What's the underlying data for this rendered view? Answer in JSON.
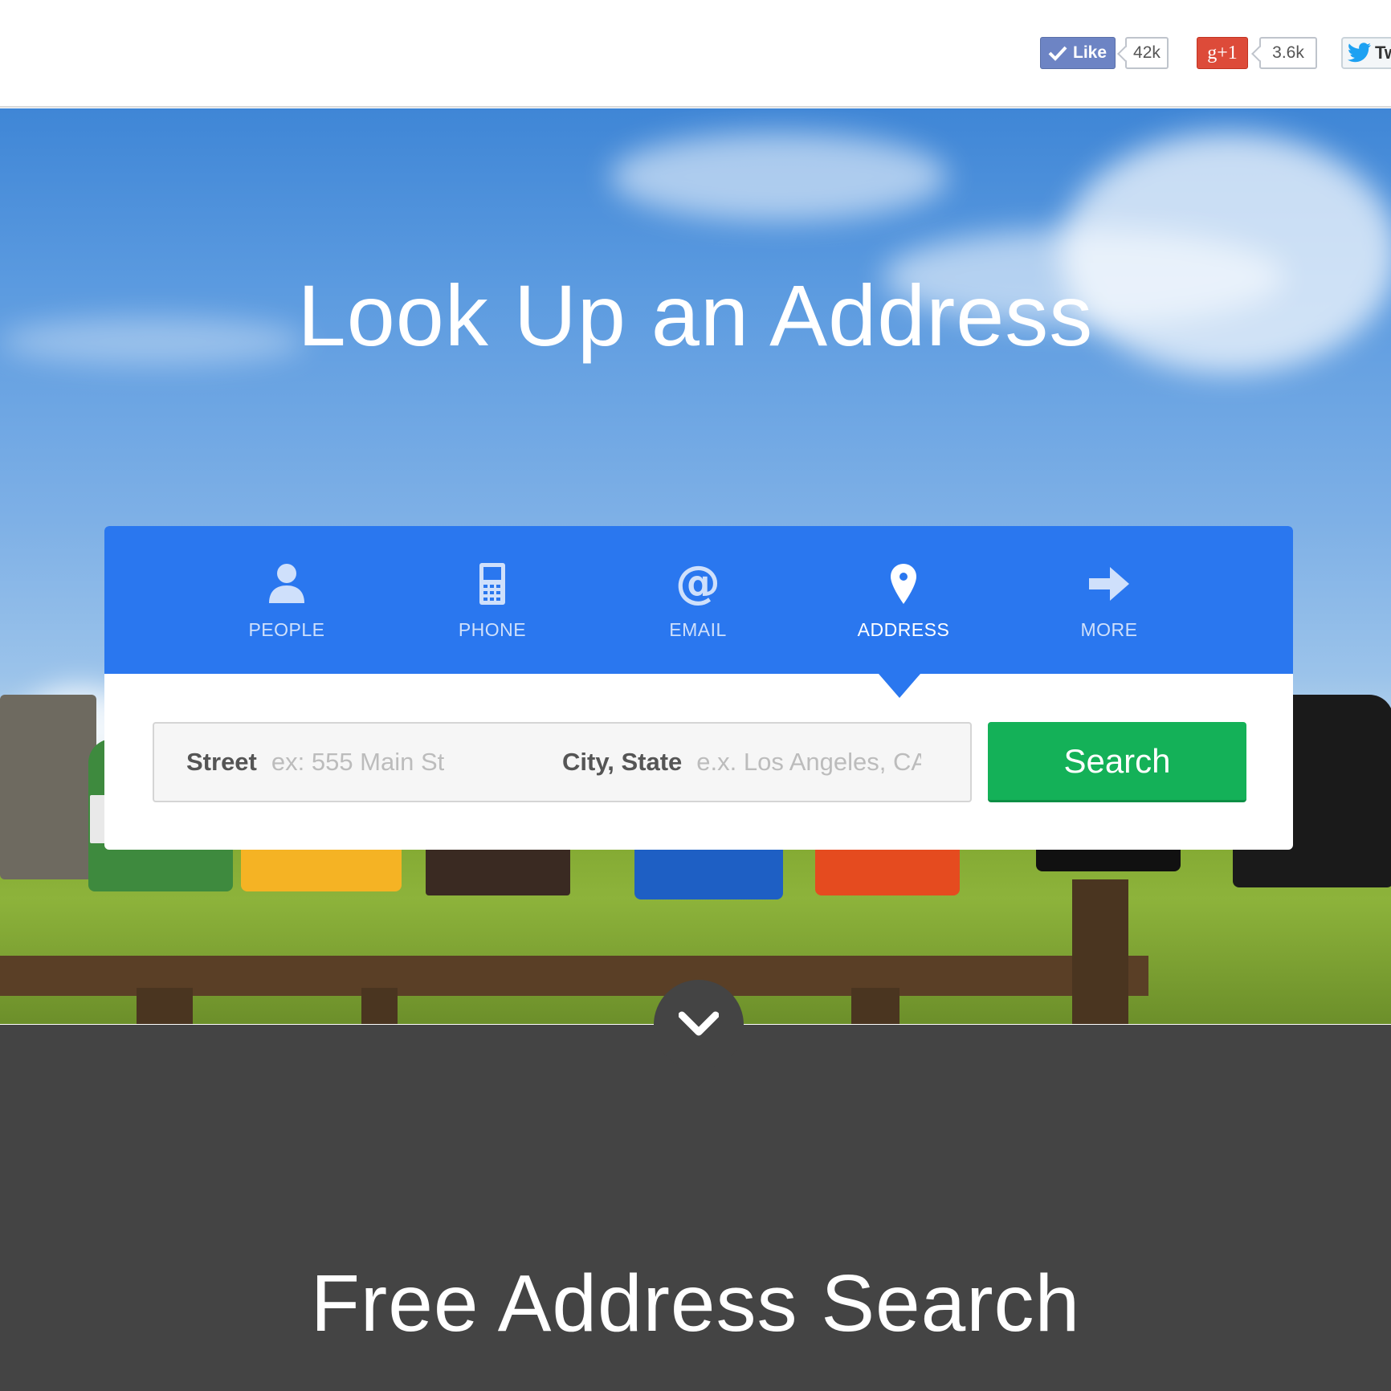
{
  "social": {
    "facebook": {
      "label": "Like",
      "count": "42k"
    },
    "gplus": {
      "label": "g+1",
      "count": "3.6k"
    },
    "twitter": {
      "label": "Tw"
    }
  },
  "hero": {
    "title": "Look Up an Address"
  },
  "tabs": [
    {
      "label": "PEOPLE",
      "icon": "person-icon",
      "active": false
    },
    {
      "label": "PHONE",
      "icon": "phone-icon",
      "active": false
    },
    {
      "label": "EMAIL",
      "icon": "at-icon",
      "active": false
    },
    {
      "label": "ADDRESS",
      "icon": "map-pin-icon",
      "active": true
    },
    {
      "label": "MORE",
      "icon": "arrow-right-icon",
      "active": false
    }
  ],
  "search": {
    "street_label": "Street",
    "street_placeholder": "ex: 555 Main St",
    "city_label": "City, State",
    "city_placeholder": "e.x. Los Angeles, CA",
    "button_label": "Search"
  },
  "section": {
    "title": "Free Address Search"
  },
  "colors": {
    "tab_bar": "#2a77ef",
    "search_button": "#14b158",
    "dark_section": "#444444"
  }
}
